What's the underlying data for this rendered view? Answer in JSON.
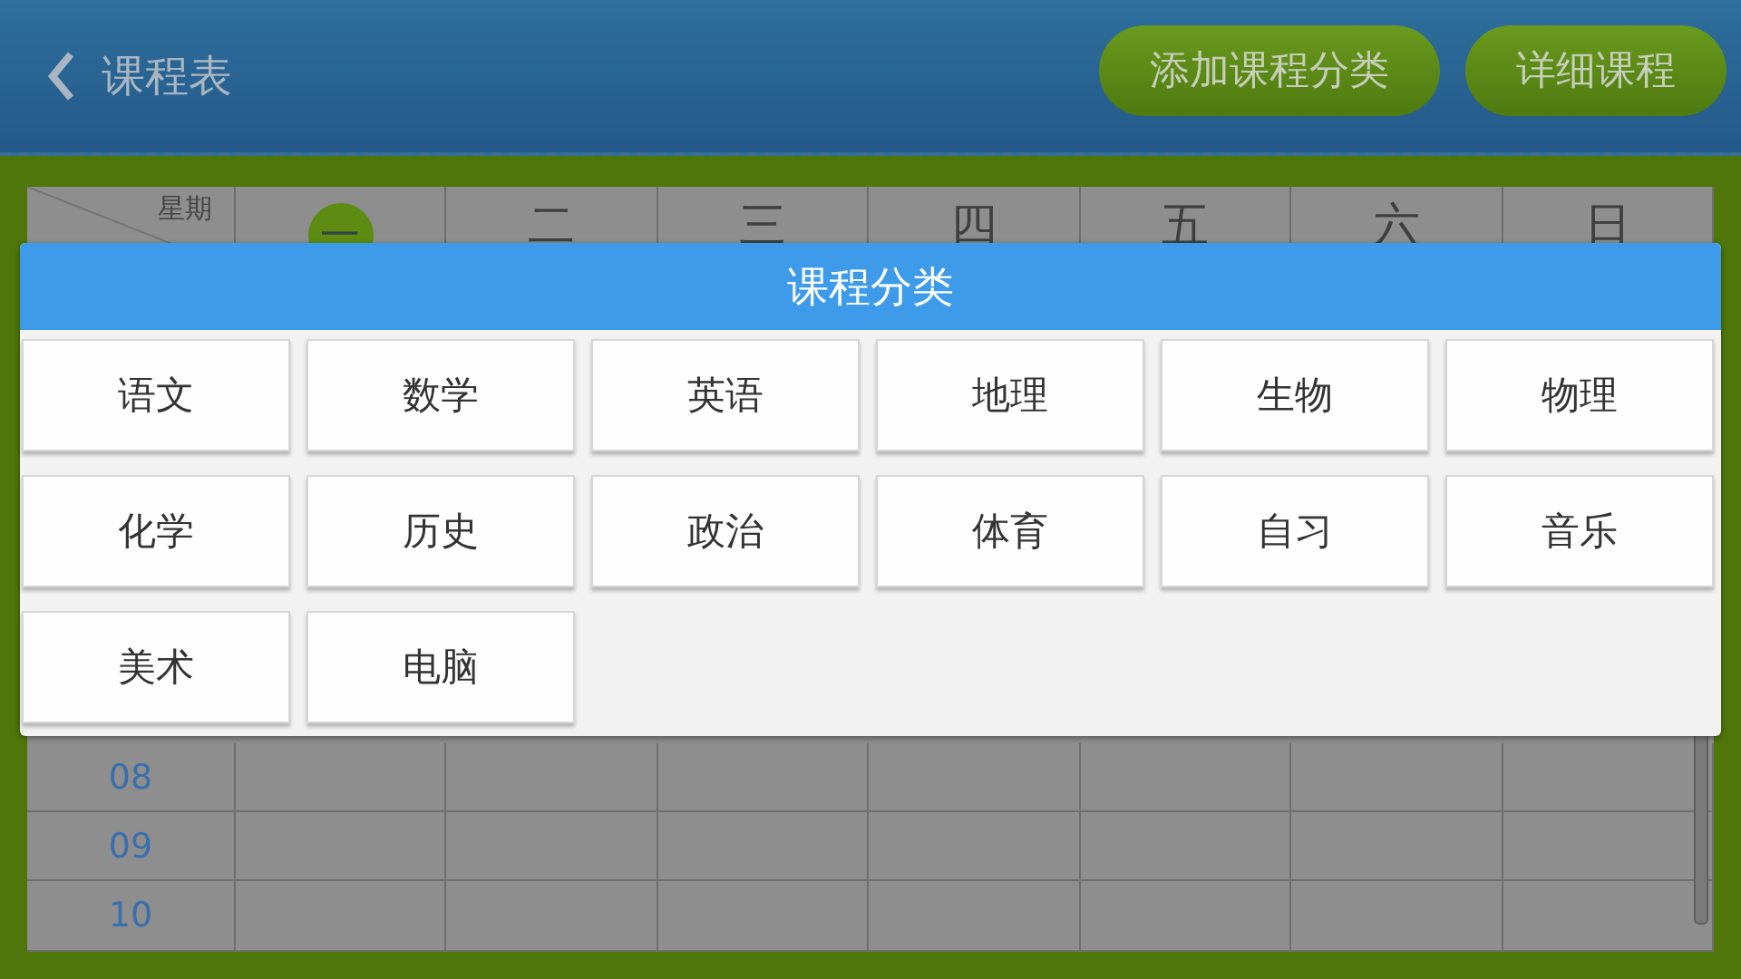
{
  "header": {
    "title": "课程表",
    "buttons": [
      "添加课程分类",
      "详细课程"
    ]
  },
  "timetable": {
    "corner": {
      "top": "星期"
    },
    "days": [
      {
        "label": "一",
        "selected": true
      },
      {
        "label": "二",
        "selected": false
      },
      {
        "label": "三",
        "selected": false
      },
      {
        "label": "四",
        "selected": false
      },
      {
        "label": "五",
        "selected": false
      },
      {
        "label": "六",
        "selected": false
      },
      {
        "label": "日",
        "selected": false
      }
    ],
    "rows": [
      "08",
      "09",
      "10"
    ]
  },
  "dialog": {
    "title": "课程分类",
    "categories": [
      "语文",
      "数学",
      "英语",
      "地理",
      "生物",
      "物理",
      "化学",
      "历史",
      "政治",
      "体育",
      "自习",
      "音乐",
      "美术",
      "电脑"
    ]
  }
}
